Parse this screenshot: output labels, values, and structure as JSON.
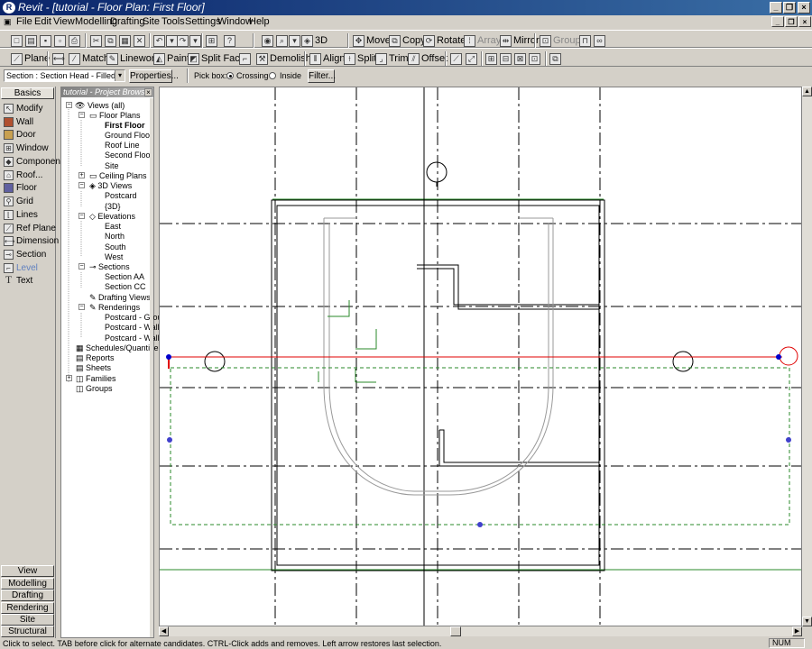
{
  "window": {
    "title": "Revit - [tutorial - Floor Plan: First Floor]"
  },
  "menu": [
    "File",
    "Edit",
    "View",
    "Modelling",
    "Drafting",
    "Site",
    "Tools",
    "Settings",
    "Window",
    "Help"
  ],
  "toolbar1": {
    "d3": "3D",
    "move": "Move",
    "copy": "Copy",
    "rotate": "Rotate",
    "array": "Array",
    "mirror": "Mirror",
    "group": "Group"
  },
  "toolbar2": {
    "plane": "Plane",
    "match": "Match",
    "linework": "Linework",
    "paint": "Paint",
    "split_face": "Split Face",
    "demolish": "Demolish",
    "align": "Align",
    "split": "Split",
    "trim": "Trim",
    "offset": "Offset"
  },
  "options": {
    "type_select": "Section : Section Head - Filled",
    "properties": "Properties...",
    "pick_box": "Pick box:",
    "crossing": "Crossing",
    "inside": "Inside",
    "filter": "Filter..."
  },
  "palette": {
    "active_tab": "Basics",
    "items": [
      "Modify",
      "Wall",
      "Door",
      "Window",
      "Component",
      "Roof...",
      "Floor",
      "Grid",
      "Lines",
      "Ref Plane",
      "Dimension",
      "Section",
      "Level",
      "Text"
    ],
    "tabs": [
      "View",
      "Modelling",
      "Drafting",
      "Rendering",
      "Site",
      "Structural"
    ]
  },
  "browser": {
    "title": "tutorial - Project Browser",
    "views_all": "Views (all)",
    "floor_plans": "Floor Plans",
    "fp": [
      "First Floor",
      "Ground Floor",
      "Roof Line",
      "Second Floor",
      "Site"
    ],
    "ceiling_plans": "Ceiling Plans",
    "views3d": "3D Views",
    "v3d": [
      "Postcard",
      "{3D}"
    ],
    "elevations": "Elevations",
    "elev": [
      "East",
      "North",
      "South",
      "West"
    ],
    "sections": "Sections",
    "sec": [
      "Section AA",
      "Section CC"
    ],
    "drafting_views": "Drafting Views",
    "renderings": "Renderings",
    "rend": [
      "Postcard - Grou",
      "Postcard - Wall",
      "Postcard - Wall"
    ],
    "schedules": "Schedules/Quantitie",
    "reports": "Reports",
    "sheets": "Sheets",
    "families": "Families",
    "groups": "Groups"
  },
  "status": {
    "message": "Click to select. TAB before click for alternate candidates. CTRL-Click adds and removes. Left arrow restores last selection.",
    "num": "NUM"
  }
}
